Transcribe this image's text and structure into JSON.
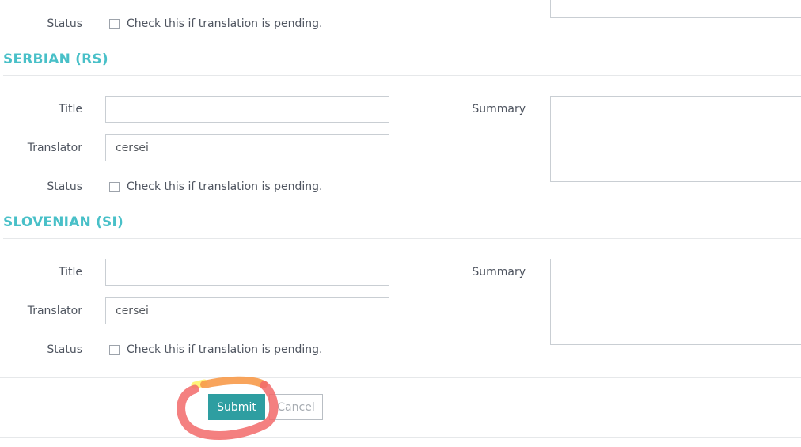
{
  "top_section": {
    "status_label": "Status",
    "pending_text": "Check this if translation is pending."
  },
  "sections": [
    {
      "heading": "SERBIAN (RS)",
      "title_label": "Title",
      "title_value": "",
      "translator_label": "Translator",
      "translator_value": "cersei",
      "status_label": "Status",
      "pending_text": "Check this if translation is pending.",
      "summary_label": "Summary"
    },
    {
      "heading": "SLOVENIAN (SI)",
      "title_label": "Title",
      "title_value": "",
      "translator_label": "Translator",
      "translator_value": "cersei",
      "status_label": "Status",
      "pending_text": "Check this if translation is pending.",
      "summary_label": "Summary"
    }
  ],
  "actions": {
    "submit_label": "Submit",
    "cancel_label": "Cancel"
  },
  "colors": {
    "heading": "#49c0c8",
    "submit_bg": "#2e9ea1",
    "annotation_stroke": "#f26a6a"
  }
}
